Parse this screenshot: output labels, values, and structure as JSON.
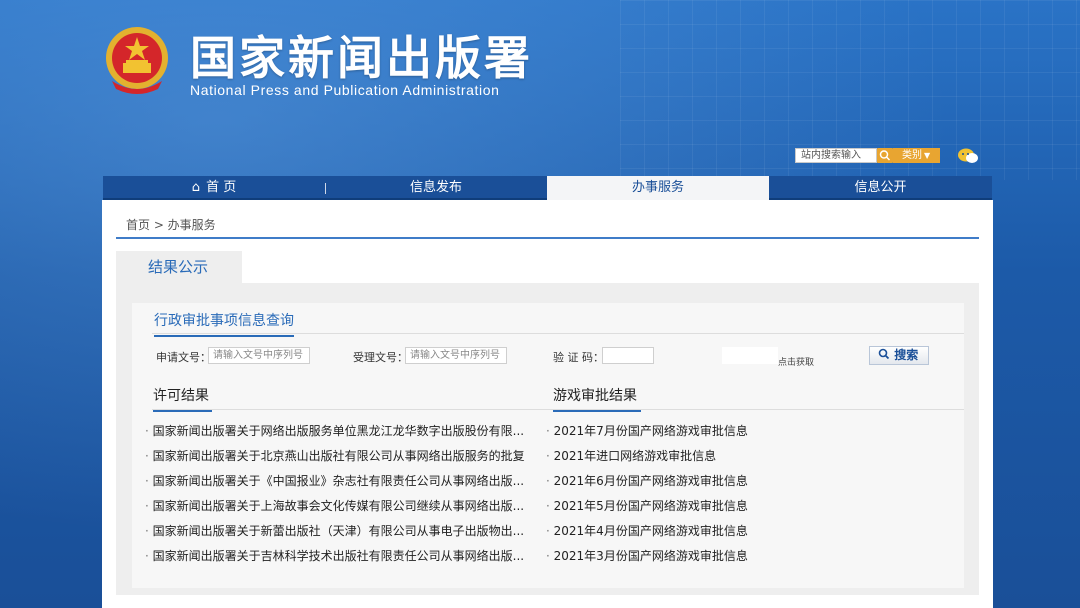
{
  "header": {
    "title_cn": "国家新闻出版署",
    "title_en": "National Press and Publication Administration"
  },
  "search": {
    "placeholder": "站内搜索输入",
    "category_label": "类别"
  },
  "nav": {
    "items": [
      {
        "label": "首 页"
      },
      {
        "label": "信息发布"
      },
      {
        "label": "办事服务"
      },
      {
        "label": "信息公开"
      }
    ],
    "active_index": 2
  },
  "breadcrumb": "首页 > 办事服务",
  "panel": {
    "tab_label": "结果公示",
    "query_title": "行政审批事项信息查询",
    "fields": {
      "apply_no_label": "申请文号：",
      "apply_no_placeholder": "请输入文号中序列号",
      "accept_no_label": "受理文号：",
      "accept_no_placeholder": "请输入文号中序列号",
      "captcha_label": "验 证 码：",
      "captcha_hint": "点击获取",
      "search_button": "搜索"
    },
    "license_title": "许可结果",
    "license_items": [
      "国家新闻出版署关于网络出版服务单位黑龙江龙华数字出版股份有限...",
      "国家新闻出版署关于北京燕山出版社有限公司从事网络出版服务的批复",
      "国家新闻出版署关于《中国报业》杂志社有限责任公司从事网络出版...",
      "国家新闻出版署关于上海故事会文化传媒有限公司继续从事网络出版...",
      "国家新闻出版署关于新蕾出版社（天津）有限公司从事电子出版物出...",
      "国家新闻出版署关于吉林科学技术出版社有限责任公司从事网络出版..."
    ],
    "game_title": "游戏审批结果",
    "game_items": [
      "2021年7月份国产网络游戏审批信息",
      "2021年进口网络游戏审批信息",
      "2021年6月份国产网络游戏审批信息",
      "2021年5月份国产网络游戏审批信息",
      "2021年4月份国产网络游戏审批信息",
      "2021年3月份国产网络游戏审批信息"
    ]
  },
  "colors": {
    "brand_blue": "#1a4f98",
    "accent_orange": "#e8a531",
    "link_blue": "#2a6bb8"
  }
}
